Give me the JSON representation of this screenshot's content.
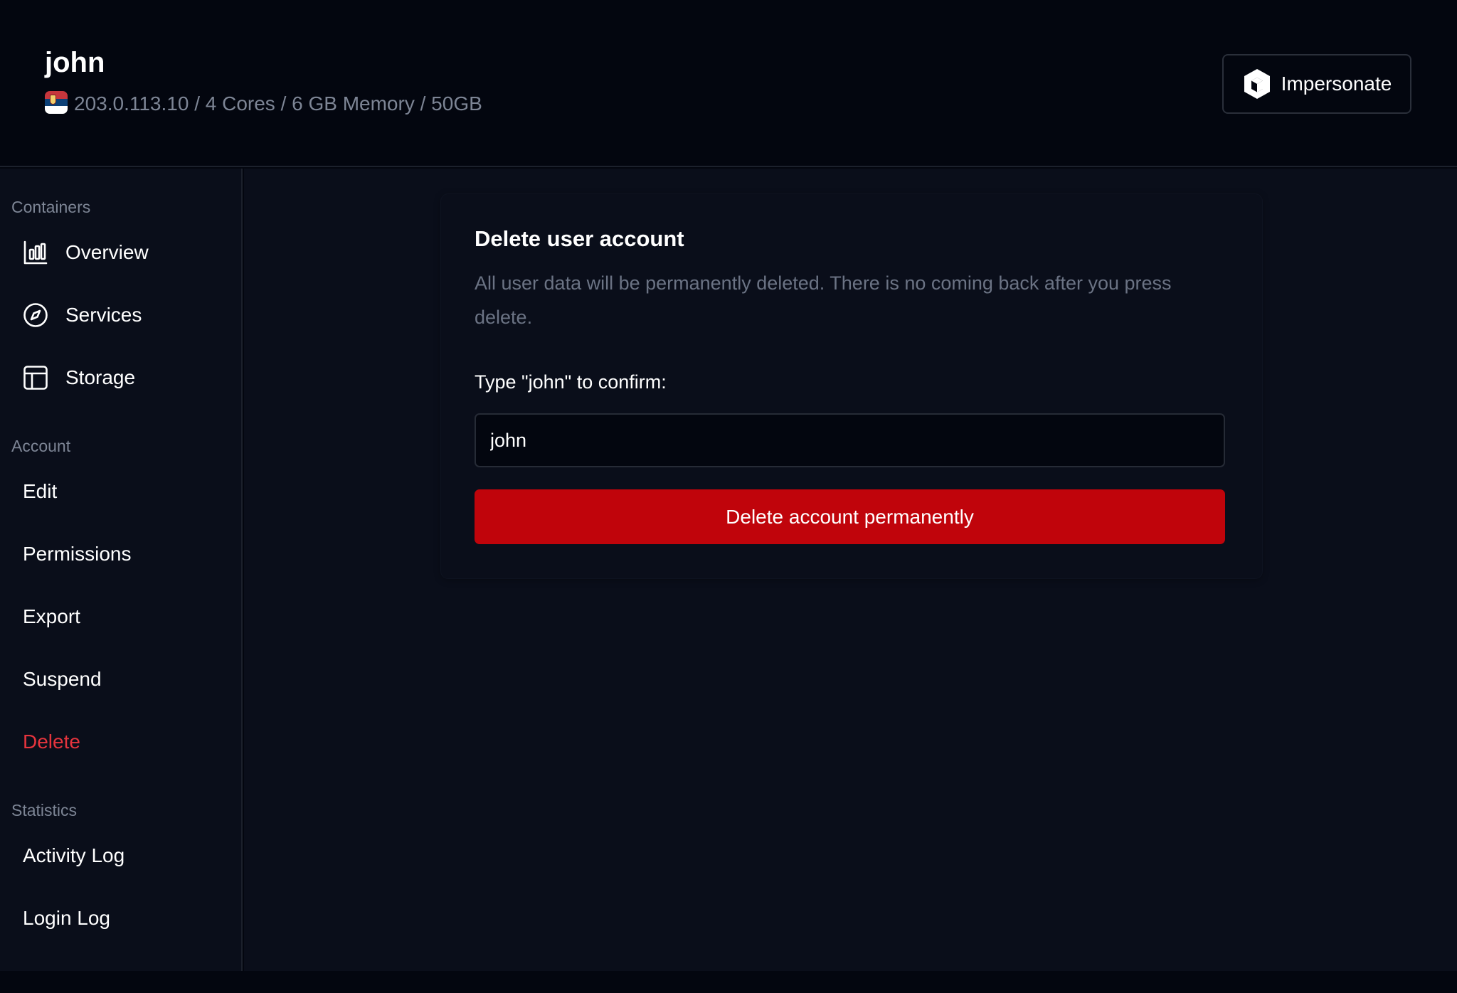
{
  "header": {
    "title": "john",
    "meta": "203.0.113.10 / 4 Cores / 6 GB Memory / 50GB",
    "flag_icon": "serbia-flag-icon",
    "impersonate_label": "Impersonate",
    "impersonate_icon": "cube-icon"
  },
  "sidebar": {
    "sections": [
      {
        "label": "Containers",
        "items": [
          {
            "label": "Overview",
            "icon": "bar-chart-icon"
          },
          {
            "label": "Services",
            "icon": "compass-icon"
          },
          {
            "label": "Storage",
            "icon": "table-icon"
          }
        ]
      },
      {
        "label": "Account",
        "items": [
          {
            "label": "Edit"
          },
          {
            "label": "Permissions"
          },
          {
            "label": "Export"
          },
          {
            "label": "Suspend"
          },
          {
            "label": "Delete",
            "active": true
          }
        ]
      },
      {
        "label": "Statistics",
        "items": [
          {
            "label": "Activity Log"
          },
          {
            "label": "Login Log"
          }
        ]
      }
    ]
  },
  "card": {
    "title": "Delete user account",
    "description": "All user data will be permanently deleted. There is no coming back after you press delete.",
    "confirm_label": "Type \"john\" to confirm:",
    "confirm_value": "john",
    "delete_button": "Delete account permanently"
  },
  "colors": {
    "background": "#0a0e1a",
    "header_background": "#03060f",
    "danger": "#c0040b",
    "danger_text": "#e5343d",
    "muted_text": "#7d8595"
  }
}
